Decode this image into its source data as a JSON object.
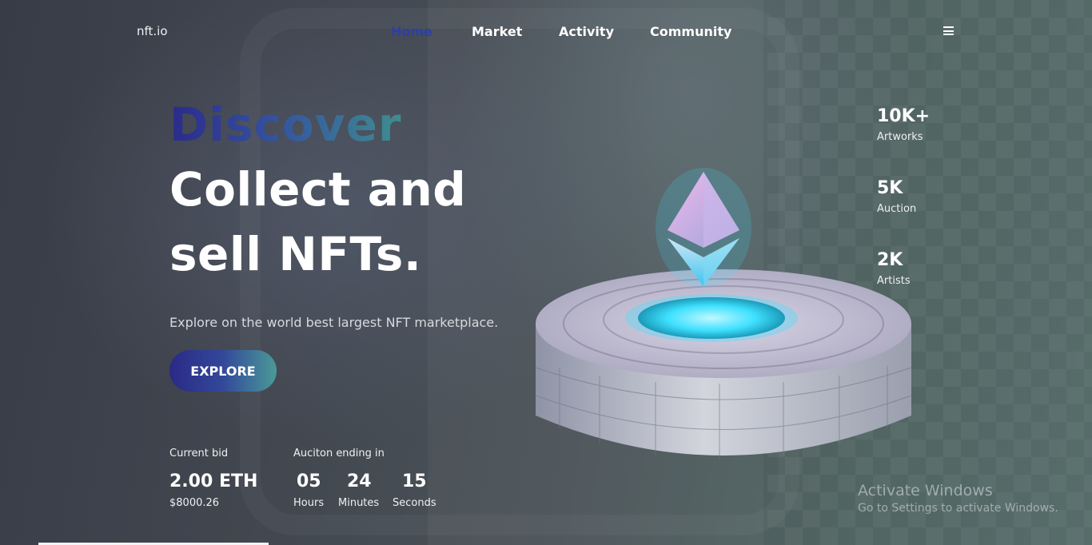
{
  "nav": {
    "logo": "nft.io",
    "links": [
      {
        "label": "Home",
        "active": true
      },
      {
        "label": "Market",
        "active": false
      },
      {
        "label": "Activity",
        "active": false
      },
      {
        "label": "Community",
        "active": false
      }
    ],
    "menu_icon": "hamburger-icon"
  },
  "hero": {
    "highlight": "Discover",
    "line1": "Collect and",
    "line2": "sell NFTs.",
    "subtitle": "Explore on the world best largest NFT marketplace.",
    "cta_label": "EXPLORE"
  },
  "bid": {
    "label": "Current bid",
    "value": "2.00 ETH",
    "usd": "$8000.26"
  },
  "auction": {
    "label": "Auciton ending in",
    "hours": "05",
    "hours_label": "Hours",
    "minutes": "24",
    "minutes_label": "Minutes",
    "seconds": "15",
    "seconds_label": "Seconds"
  },
  "stats": [
    {
      "value": "10K+",
      "label": "Artworks"
    },
    {
      "value": "5K",
      "label": "Auction"
    },
    {
      "value": "2K",
      "label": "Artists"
    }
  ],
  "watermark": {
    "title": "Activate Windows",
    "subtitle": "Go to Settings to activate Windows."
  },
  "colors": {
    "accent_dark": "#2a2a86",
    "accent_teal": "#4a9a98",
    "portal_glow": "#3ee0ff"
  }
}
